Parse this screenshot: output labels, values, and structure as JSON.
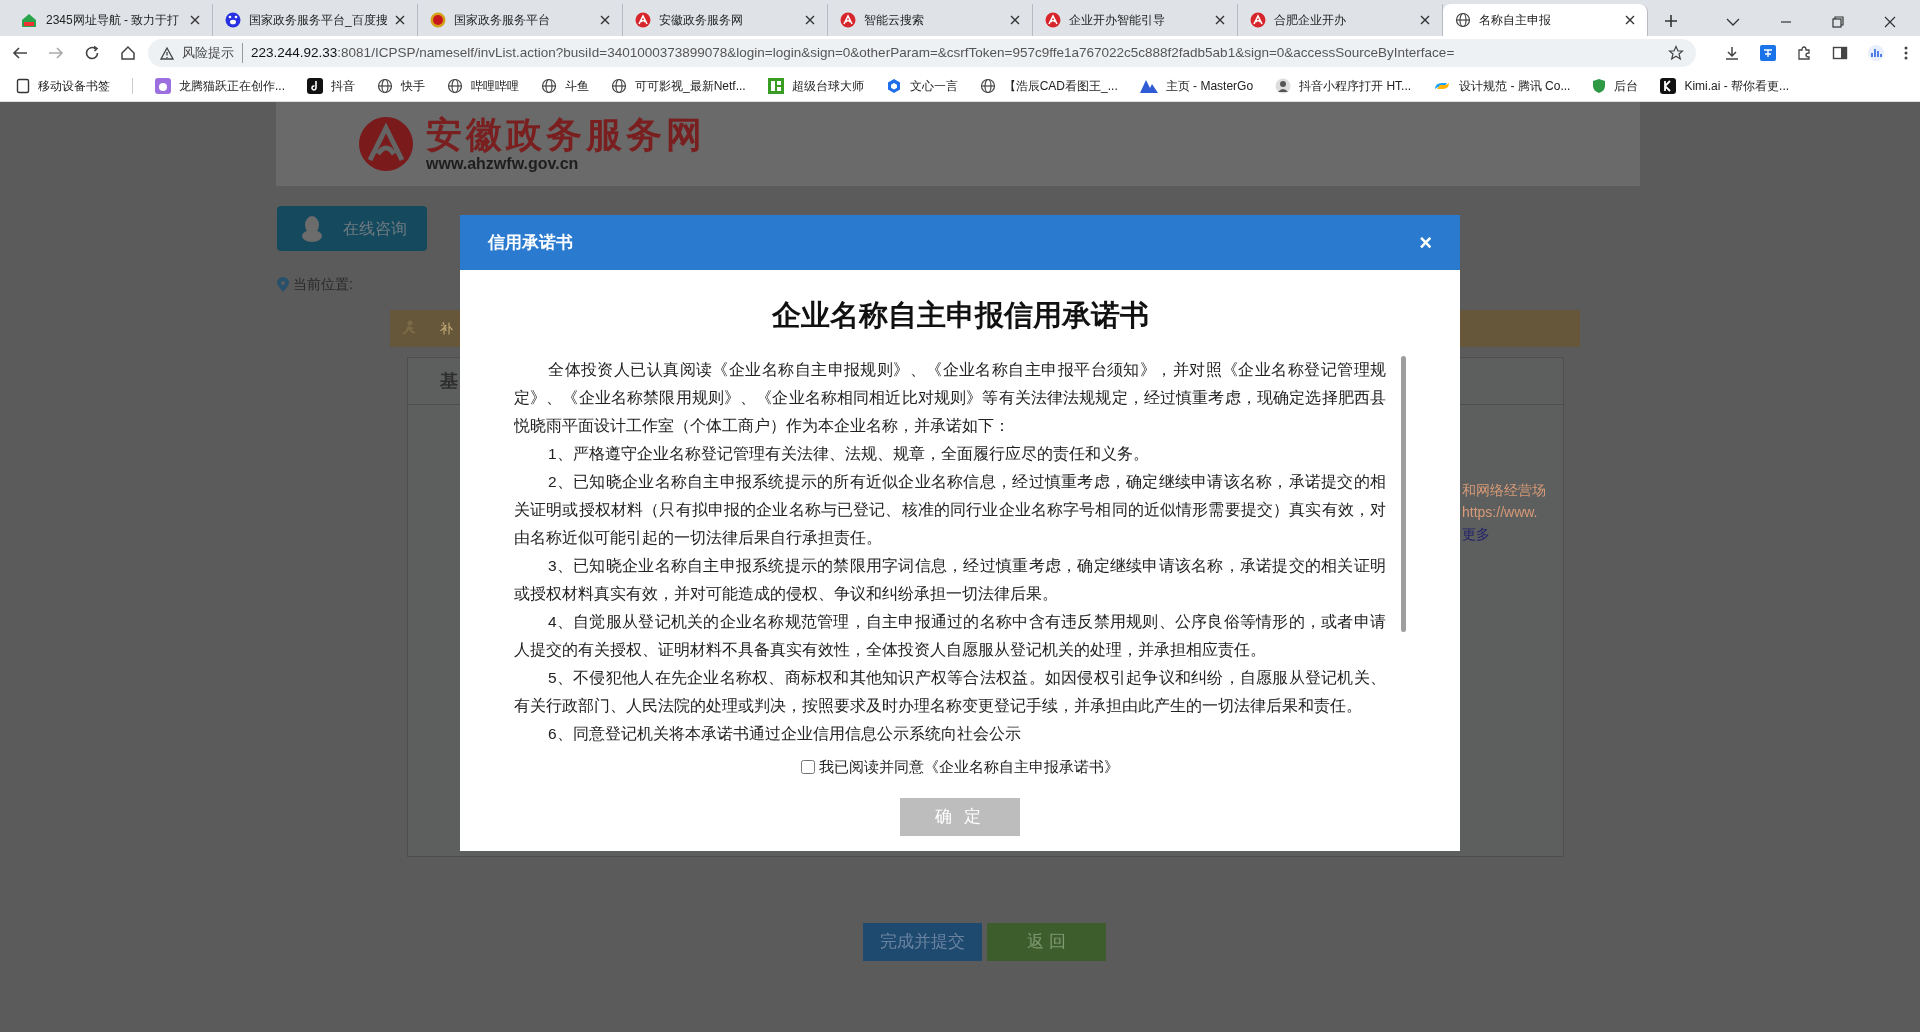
{
  "browser": {
    "tabs": [
      {
        "title": "2345网址导航 - 致力于打",
        "selected": false
      },
      {
        "title": "国家政务服务平台_百度搜",
        "selected": false
      },
      {
        "title": "国家政务服务平台",
        "selected": false
      },
      {
        "title": "安徽政务服务网",
        "selected": false
      },
      {
        "title": "智能云搜索",
        "selected": false
      },
      {
        "title": "企业开办智能引导",
        "selected": false
      },
      {
        "title": "合肥企业开办",
        "selected": false
      },
      {
        "title": "名称自主申报",
        "selected": true
      }
    ],
    "security_label": "风险提示",
    "url_host": "223.244.92.33",
    "url_rest": ":8081/ICPSP/nameself/invList.action?busiId=3401000373899078&login=login&sign=0&otherParam=&csrfToken=957c9ffe1a767022c5c888f2fadb5ab1&sign=0&accessSourceByInterface=",
    "bookmarks": [
      "移动设备书签",
      "龙腾猫跃正在创作...",
      "抖音",
      "快手",
      "哔哩哔哩",
      "斗鱼",
      "可可影视_最新Netf...",
      "超级台球大师",
      "文心一言",
      "【浩辰CAD看图王_...",
      "主页 - MasterGo",
      "抖音小程序打开 HT...",
      "设计规范 - 腾讯 Co...",
      "后台",
      "Kimi.ai - 帮你看更..."
    ]
  },
  "page": {
    "site_name": "安徽政务服务网",
    "site_url": "www.ahzwfw.gov.cn",
    "consult_button": "在线咨询",
    "breadcrumb_label": "当前位置:",
    "step_label": "补",
    "section_title": "基",
    "side_text": [
      "和网络经营场",
      "https://www.",
      "更多"
    ],
    "buttons": [
      {
        "label": "完成并提交",
        "kind": "primary"
      },
      {
        "label": "返 回",
        "kind": "secondary"
      }
    ]
  },
  "modal": {
    "title": "信用承诺书",
    "close": "×",
    "heading": "企业名称自主申报信用承诺书",
    "paragraphs": [
      "全体投资人已认真阅读《企业名称自主申报规则》、《企业名称自主申报平台须知》，并对照《企业名称登记管理规定》、《企业名称禁限用规则》、《企业名称相同相近比对规则》等有关法律法规规定，经过慎重考虑，现确定选择肥西县悦晓雨平面设计工作室（个体工商户）作为本企业名称，并承诺如下：",
      "1、严格遵守企业名称登记管理有关法律、法规、规章，全面履行应尽的责任和义务。",
      "2、已知晓企业名称自主申报系统提示的所有近似企业名称信息，经过慎重考虑，确定继续申请该名称，承诺提交的相关证明或授权材料（只有拟申报的企业名称与已登记、核准的同行业企业名称字号相同的近似情形需要提交）真实有效，对由名称近似可能引起的一切法律后果自行承担责任。",
      "3、已知晓企业名称自主申报系统提示的禁限用字词信息，经过慎重考虑，确定继续申请该名称，承诺提交的相关证明或授权材料真实有效，并对可能造成的侵权、争议和纠纷承担一切法律后果。",
      "4、自觉服从登记机关的企业名称规范管理，自主申报通过的名称中含有违反禁用规则、公序良俗等情形的，或者申请人提交的有关授权、证明材料不具备真实有效性，全体投资人自愿服从登记机关的处理，并承担相应责任。",
      "5、不侵犯他人在先企业名称权、商标权和其他知识产权等合法权益。如因侵权引起争议和纠纷，自愿服从登记机关、有关行政部门、人民法院的处理或判决，按照要求及时办理名称变更登记手续，并承担由此产生的一切法律后果和责任。",
      "6、同意登记机关将本承诺书通过企业信用信息公示系统向社会公示"
    ],
    "agree": {
      "label": "我已阅读并同意《企业名称自主申报承诺书》",
      "checked": false
    },
    "confirm": {
      "label": "确 定",
      "disabled": true
    }
  }
}
